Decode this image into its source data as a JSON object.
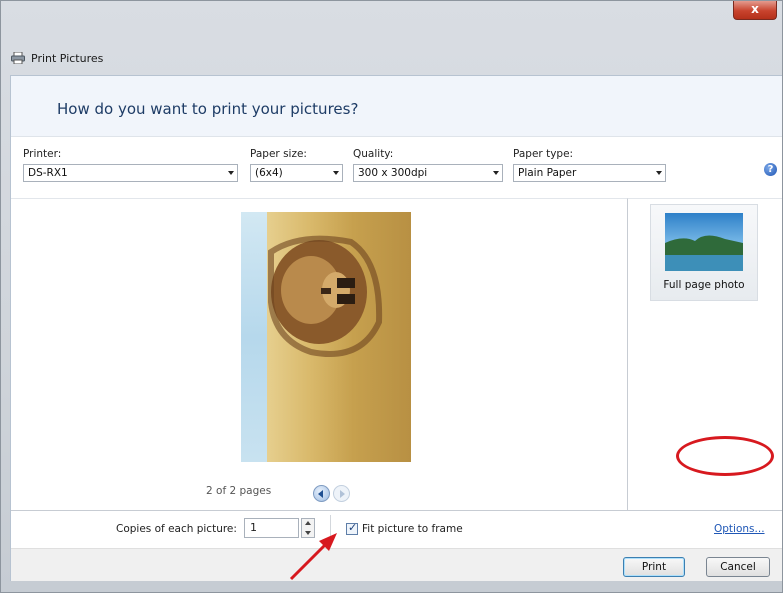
{
  "window": {
    "title": "Print Pictures",
    "close_glyph": "x"
  },
  "header": {
    "question": "How do you want to print your pictures?"
  },
  "settings": {
    "printer": {
      "label": "Printer:",
      "value": "DS-RX1"
    },
    "paper_size": {
      "label": "Paper size:",
      "value": "(6x4)"
    },
    "quality": {
      "label": "Quality:",
      "value": "300 x 300dpi"
    },
    "paper_type": {
      "label": "Paper type:",
      "value": "Plain Paper"
    },
    "help_glyph": "?"
  },
  "preview": {
    "pages_text": "2 of 2 pages"
  },
  "layouts": {
    "selected_label": "Full page photo"
  },
  "bottom": {
    "copies_label": "Copies of each picture:",
    "copies_value": "1",
    "fit_label": "Fit picture to frame",
    "fit_checked": true,
    "check_glyph": "✓",
    "options_link": "Options..."
  },
  "footer": {
    "print_button": "Print",
    "cancel_button": "Cancel"
  },
  "annotations": {
    "highlight_color": "#d7191f"
  },
  "icons": [
    "printer-icon",
    "help-icon",
    "chevron-down-icon",
    "left-arrow-icon",
    "right-arrow-icon",
    "spin-up-icon",
    "spin-down-icon"
  ]
}
